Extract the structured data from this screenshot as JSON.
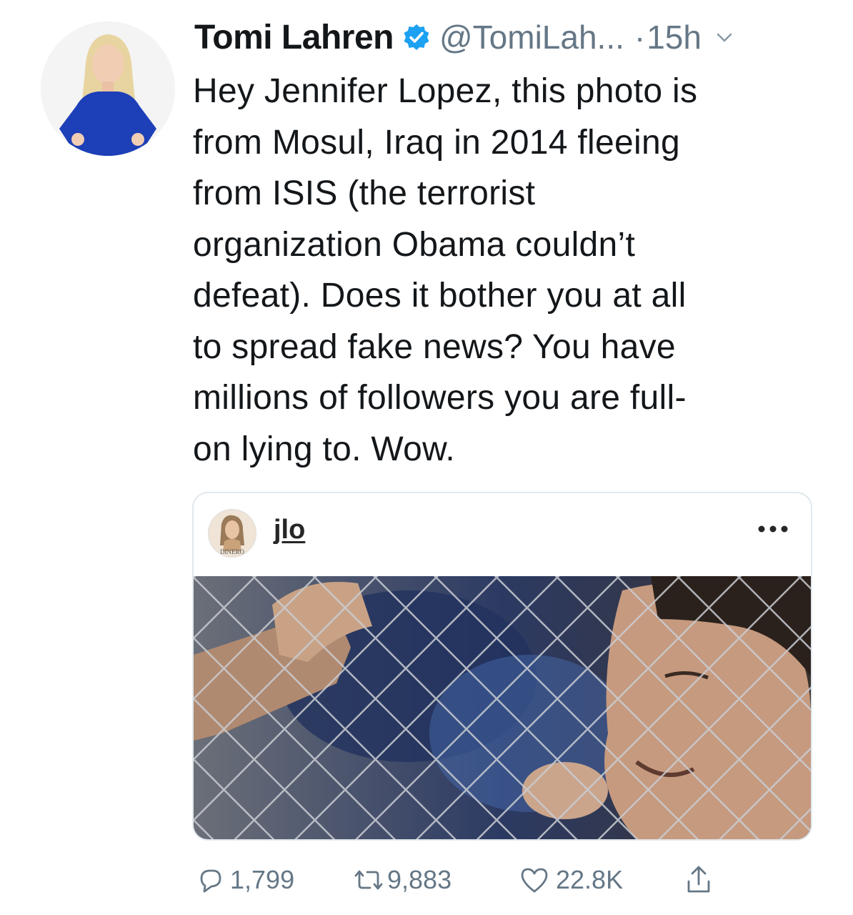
{
  "tweet": {
    "author_name": "Tomi Lahren",
    "handle": "@TomiLah...",
    "separator": "·",
    "time": "15h",
    "text": "Hey Jennifer Lopez, this photo is\nfrom Mosul, Iraq in 2014 fleeing\nfrom ISIS (the terrorist\norganization Obama couldn’t\ndefeat). Does it bother you at all\nto spread fake news? You have\nmillions of followers you are full-\non lying to. Wow."
  },
  "embedded_post": {
    "username": "jlo",
    "avatar_text": "DINERO"
  },
  "stats": {
    "replies": "1,799",
    "retweets": "9,883",
    "likes": "22.8K"
  },
  "colors": {
    "verified_blue": "#1da1f2",
    "muted_gray": "#657786",
    "text": "#14171a",
    "card_border": "#e1e8ed"
  },
  "icons": [
    "verified-badge-icon",
    "chevron-down-icon",
    "more-dots-icon",
    "reply-icon",
    "retweet-icon",
    "like-icon",
    "share-icon"
  ]
}
